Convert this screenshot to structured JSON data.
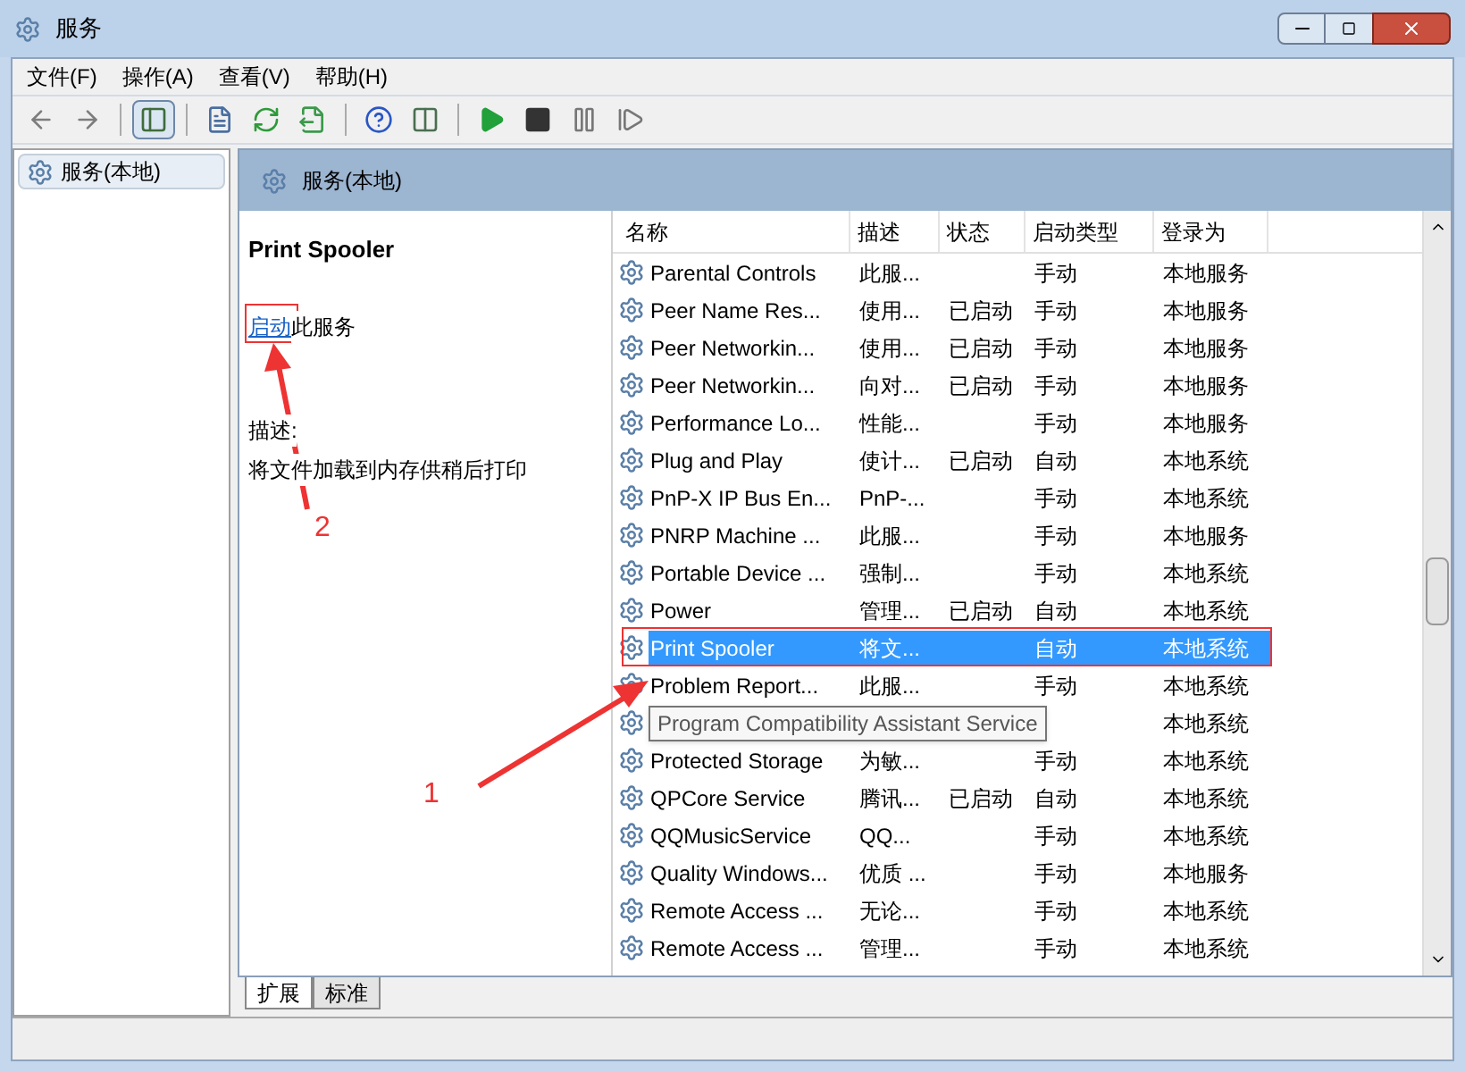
{
  "window": {
    "title": "服务"
  },
  "menu": [
    "文件(F)",
    "操作(A)",
    "查看(V)",
    "帮助(H)"
  ],
  "toolbar": {
    "tree_toggle_pressed": true
  },
  "tree": {
    "items": [
      {
        "label": "服务(本地)",
        "selected": true
      }
    ]
  },
  "panel": {
    "title": "服务(本地)"
  },
  "detail": {
    "service_name": "Print Spooler",
    "action_link": "启动",
    "action_text": "此服务",
    "description_label": "描述:",
    "description": "将文件加载到内存供稍后打印"
  },
  "table": {
    "columns": [
      "名称",
      "描述",
      "状态",
      "启动类型",
      "登录为"
    ],
    "rows": [
      {
        "name": "Parental Controls",
        "description": "此服...",
        "startup": "手动",
        "logon": "本地服务",
        "selected": false
      },
      {
        "name": "Peer Name Res...",
        "description": "使用...",
        "status": "已启动",
        "startup": "手动",
        "logon": "本地服务",
        "selected": false
      },
      {
        "name": "Peer Networkin...",
        "description": "使用...",
        "status": "已启动",
        "startup": "手动",
        "logon": "本地服务",
        "selected": false
      },
      {
        "name": "Peer Networkin...",
        "description": "向对...",
        "status": "已启动",
        "startup": "手动",
        "logon": "本地服务",
        "selected": false
      },
      {
        "name": "Performance Lo...",
        "description": "性能...",
        "startup": "手动",
        "logon": "本地服务",
        "selected": false
      },
      {
        "name": "Plug and Play",
        "description": "使计...",
        "status": "已启动",
        "startup": "自动",
        "logon": "本地系统",
        "selected": false
      },
      {
        "name": "PnP-X IP Bus En...",
        "description": "PnP-...",
        "startup": "手动",
        "logon": "本地系统",
        "selected": false
      },
      {
        "name": "PNRP Machine ...",
        "description": "此服...",
        "startup": "手动",
        "logon": "本地服务",
        "selected": false
      },
      {
        "name": "Portable Device ...",
        "description": "强制...",
        "startup": "手动",
        "logon": "本地系统",
        "selected": false
      },
      {
        "name": "Power",
        "description": "管理...",
        "status": "已启动",
        "startup": "自动",
        "logon": "本地系统",
        "selected": false
      },
      {
        "name": "Print Spooler",
        "description": "将文...",
        "startup": "自动",
        "logon": "本地系统",
        "selected": true
      },
      {
        "name": "Problem Report...",
        "description": "此服...",
        "startup": "手动",
        "logon": "本地系统",
        "selected": false
      },
      {
        "logon": "本地系统",
        "selected": false
      },
      {
        "name": "Protected Storage",
        "description": "为敏...",
        "startup": "手动",
        "logon": "本地系统",
        "selected": false
      },
      {
        "name": "QPCore Service",
        "description": "腾讯...",
        "status": "已启动",
        "startup": "自动",
        "logon": "本地系统",
        "selected": false
      },
      {
        "name": "QQMusicService",
        "description": "QQ...",
        "startup": "手动",
        "logon": "本地系统",
        "selected": false
      },
      {
        "name": "Quality Windows...",
        "description": "优质 ...",
        "startup": "手动",
        "logon": "本地服务",
        "selected": false
      },
      {
        "name": "Remote Access ...",
        "description": "无论...",
        "startup": "手动",
        "logon": "本地系统",
        "selected": false
      },
      {
        "name": "Remote Access ...",
        "description": "管理...",
        "startup": "手动",
        "logon": "本地系统",
        "selected": false
      }
    ]
  },
  "tooltip": {
    "text": "Program Compatibility Assistant Service"
  },
  "tabs": [
    {
      "label": "扩展",
      "selected": true
    },
    {
      "label": "标准",
      "selected": false
    }
  ],
  "annotations": [
    {
      "label": "1"
    },
    {
      "label": "2"
    }
  ]
}
